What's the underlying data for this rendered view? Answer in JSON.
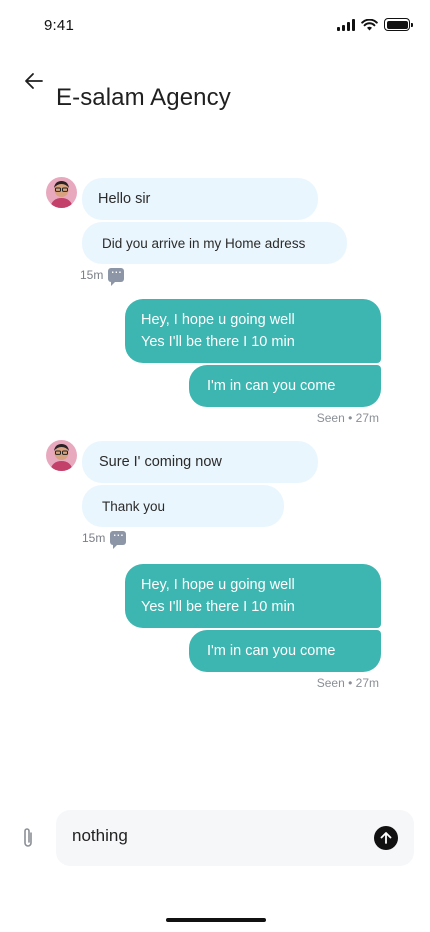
{
  "status_bar": {
    "time": "9:41"
  },
  "header": {
    "title": "E-salam Agency"
  },
  "messages": [
    {
      "text": "Hello sir"
    },
    {
      "text": "Did you arrive in my Home adress"
    },
    {
      "time": "15m"
    },
    {
      "line1": "Hey, I hope u going well",
      "line2": "Yes I'll be there I 10 min"
    },
    {
      "text": "I'm in can you come"
    },
    {
      "status": "Seen • 27m"
    },
    {
      "text": "Sure I' coming now"
    },
    {
      "text": "Thank you"
    },
    {
      "time": "15m"
    },
    {
      "line1": "Hey, I hope u going well",
      "line2": "Yes I'll be there I 10 min"
    },
    {
      "text": "I'm in can you come"
    },
    {
      "status": "Seen • 27m"
    }
  ],
  "composer": {
    "value": "nothing"
  },
  "colors": {
    "accent": "#3db5b0",
    "incoming": "#eaf6fd",
    "input_bg": "#f6f7f9"
  },
  "icons": {
    "back": "arrow-left-icon",
    "attach": "paperclip-icon",
    "send": "arrow-up-icon",
    "read": "chat-dots-icon"
  }
}
